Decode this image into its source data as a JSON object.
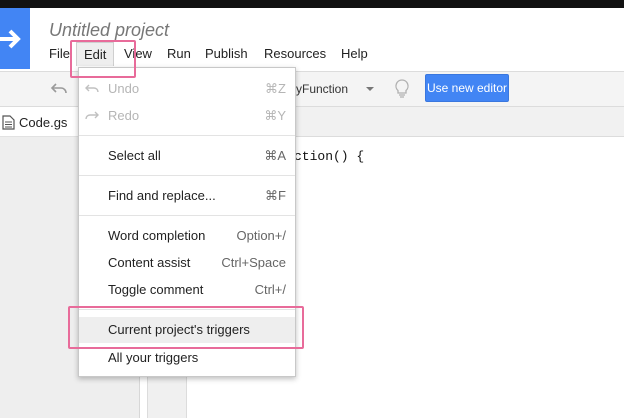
{
  "project": {
    "title": "Untitled project"
  },
  "menubar": {
    "items": [
      {
        "label": "File"
      },
      {
        "label": "Edit"
      },
      {
        "label": "View"
      },
      {
        "label": "Run"
      },
      {
        "label": "Publish"
      },
      {
        "label": "Resources"
      },
      {
        "label": "Help"
      }
    ]
  },
  "toolbar": {
    "function_select": "yFunction",
    "new_editor_label": "Use new editor"
  },
  "sidebar": {
    "files": [
      {
        "name": "Code.gs"
      }
    ]
  },
  "editor": {
    "visible_code": "ction() {"
  },
  "edit_menu": {
    "items": [
      {
        "label": "Undo",
        "shortcut": "⌘Z",
        "enabled": false
      },
      {
        "label": "Redo",
        "shortcut": "⌘Y",
        "enabled": false
      },
      {
        "label": "Select all",
        "shortcut": "⌘A",
        "enabled": true
      },
      {
        "label": "Find and replace...",
        "shortcut": "⌘F",
        "enabled": true
      },
      {
        "label": "Word completion",
        "shortcut": "Option+/",
        "enabled": true
      },
      {
        "label": "Content assist",
        "shortcut": "Ctrl+Space",
        "enabled": true
      },
      {
        "label": "Toggle comment",
        "shortcut": "Ctrl+/",
        "enabled": true
      },
      {
        "label": "Current project's triggers",
        "shortcut": "",
        "enabled": true
      },
      {
        "label": "All your triggers",
        "shortcut": "",
        "enabled": true
      }
    ]
  },
  "colors": {
    "accent": "#4285f4",
    "highlight": "#e86b9a"
  }
}
